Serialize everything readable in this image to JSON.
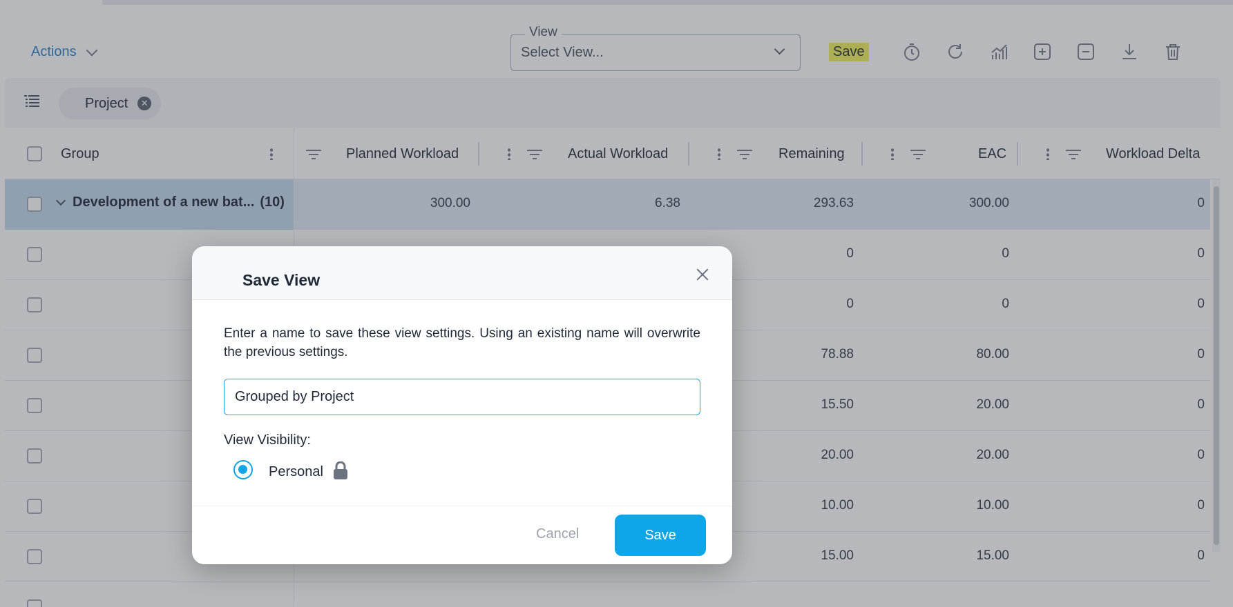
{
  "toolbar": {
    "actions_label": "Actions",
    "view_legend": "View",
    "view_value": "Select View...",
    "save_label": "Save"
  },
  "filter": {
    "chip_label": "Project"
  },
  "grid": {
    "columns": [
      "Group",
      "Planned Workload",
      "Actual Workload",
      "Remaining",
      "EAC",
      "Workload Delta"
    ],
    "group_row": {
      "name": "Development of a new bat...",
      "count": "(10)",
      "planned": "300.00",
      "actual": "6.38",
      "remaining": "293.63",
      "eac": "300.00",
      "delta": "0"
    },
    "rows": [
      {
        "remaining": "0",
        "eac": "0",
        "delta": "0"
      },
      {
        "remaining": "0",
        "eac": "0",
        "delta": "0"
      },
      {
        "remaining": "78.88",
        "eac": "80.00",
        "delta": "0"
      },
      {
        "remaining": "15.50",
        "eac": "20.00",
        "delta": "0"
      },
      {
        "remaining": "20.00",
        "eac": "20.00",
        "delta": "0"
      },
      {
        "remaining": "10.00",
        "eac": "10.00",
        "delta": "0"
      },
      {
        "remaining": "15.00",
        "eac": "15.00",
        "delta": "0"
      }
    ]
  },
  "modal": {
    "title": "Save View",
    "description": "Enter a name to save these view settings. Using an existing name will overwrite the previous settings.",
    "name_value": "Grouped by Project",
    "visibility_label": "View Visibility:",
    "visibility_option": "Personal",
    "cancel_label": "Cancel",
    "save_label": "Save"
  },
  "colors": {
    "accent": "#0ea5e9",
    "link": "#1677c8",
    "highlight": "#eef04a",
    "group_row": "#dbe7f3"
  },
  "icons": [
    "chevron-down-icon",
    "timer-icon",
    "refresh-icon",
    "chart-icon",
    "expand-plus-icon",
    "collapse-minus-icon",
    "download-icon",
    "trash-icon",
    "list-icon",
    "close-circle-icon",
    "kebab-icon",
    "filter-icon",
    "close-icon",
    "lock-icon"
  ]
}
